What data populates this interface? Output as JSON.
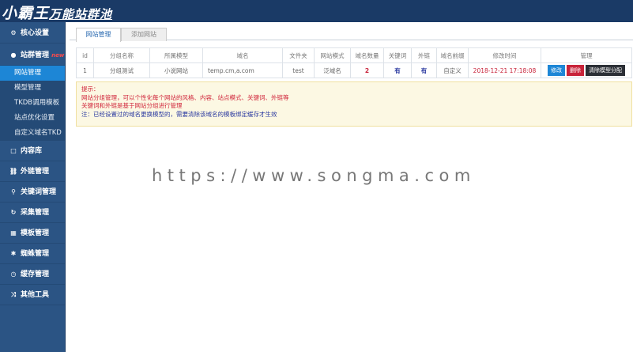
{
  "header": {
    "logo_main": "小霸王",
    "logo_sub": "万能站群池"
  },
  "sidebar": {
    "core": "核心设置",
    "group": "站群管理",
    "group_badge": "new",
    "sub": [
      "网站管理",
      "模型管理",
      "TKDB调用模板",
      "站点优化设置",
      "自定义域名TKD"
    ],
    "sections": [
      {
        "label": "内容库",
        "icon": "□"
      },
      {
        "label": "外链管理",
        "icon": "⛓"
      },
      {
        "label": "关键词管理",
        "icon": "⚲"
      },
      {
        "label": "采集管理",
        "icon": "↻"
      },
      {
        "label": "模板管理",
        "icon": "▦"
      },
      {
        "label": "蜘蛛管理",
        "icon": "✱"
      },
      {
        "label": "缓存管理",
        "icon": "◷"
      },
      {
        "label": "其他工具",
        "icon": "⤨"
      }
    ]
  },
  "tabs": [
    "网站管理",
    "添加网站"
  ],
  "table": {
    "headers": [
      "id",
      "分组名称",
      "所属模型",
      "域名",
      "文件夹",
      "网站模式",
      "域名数量",
      "关键词",
      "外链",
      "域名前缀",
      "修改时间",
      "管理"
    ],
    "rows": [
      {
        "id": "1",
        "name": "分组测试",
        "model": "小说网站",
        "domain": "temp.cm,a.com",
        "folder": "test",
        "mode": "泛域名",
        "count": "2",
        "keywords": "有",
        "links": "有",
        "prefix": "自定义",
        "time": "2018-12-21 17:18:08",
        "edit": "修改",
        "delete": "删除",
        "clear": "清除模型分配"
      }
    ]
  },
  "notice": {
    "title": "提示：",
    "line1": "网站分组管理，可以个性化每个网站的风格、内容、站点模式、关键词、外链等",
    "line2": "关键词和外链是基于网站分组进行管理",
    "line3": "注：已经设置过的域名更换模型的，需要清除该域名的模板绑定缓存才生效"
  },
  "watermark": "https://www.songma.com",
  "colors": {
    "header": "#1a3a66",
    "sidebar": "#2b5484",
    "active": "#1d86d6",
    "edit": "#1d86d6",
    "delete": "#c8233a",
    "clear": "#2b2f36"
  }
}
